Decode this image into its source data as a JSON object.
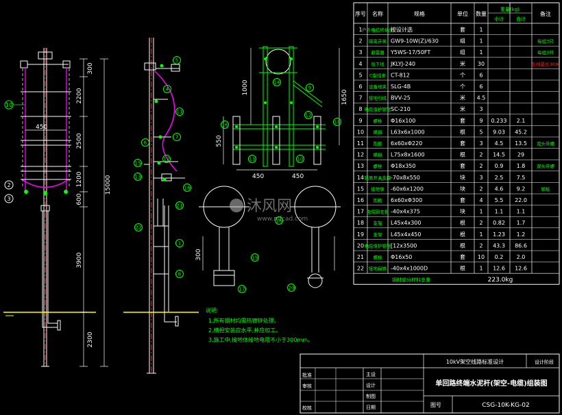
{
  "colors": {
    "background": "#000000",
    "line_white": "#ffffff",
    "line_green": "#00ff00",
    "line_magenta": "#ff00ff",
    "line_red": "#ff3030",
    "line_yellow": "#ffff00",
    "line_cyan": "#00ffff",
    "text_green": "#00ff00",
    "text_red": "#ff2020",
    "line_blue": "#3040ff"
  },
  "watermark": {
    "text": "沐风网",
    "url": "www.mfcad.com"
  },
  "table": {
    "headers": {
      "seq": "序号",
      "name": "名称",
      "spec": "规格",
      "unit": "单位",
      "qty": "数量",
      "weight": "重量(kg)",
      "sub": "小计",
      "total": "合计",
      "remark": "备注"
    },
    "rows": [
      {
        "n": "1",
        "name": "户外电缆终端头",
        "spec": "按设计选",
        "unit": "套",
        "qty": "1",
        "sub": "",
        "total": "",
        "remark": ""
      },
      {
        "n": "2",
        "name": "隔离开关",
        "spec": "GW9-10W(Z)/630",
        "unit": "组",
        "qty": "1",
        "sub": "",
        "total": "",
        "remark": "每组3只"
      },
      {
        "n": "3",
        "name": "避雷器",
        "spec": "Y5WS-17/50FT",
        "unit": "组",
        "qty": "1",
        "sub": "",
        "total": "",
        "remark": "每组3只"
      },
      {
        "n": "4",
        "name": "引下线",
        "spec": "JKLYJ-240",
        "unit": "米",
        "qty": "30",
        "sub": "",
        "total": "",
        "remark": "引线最长30米"
      },
      {
        "n": "5",
        "name": "C型线夹",
        "spec": "CT-812",
        "unit": "个",
        "qty": "6",
        "sub": "",
        "total": "",
        "remark": ""
      },
      {
        "n": "6",
        "name": "设备线夹",
        "spec": "SLG-4B",
        "unit": "个",
        "qty": "6",
        "sub": "",
        "total": "",
        "remark": ""
      },
      {
        "n": "7",
        "name": "接地引线",
        "spec": "BVV-25",
        "unit": "米",
        "qty": "4.5",
        "sub": "",
        "total": "",
        "remark": ""
      },
      {
        "n": "8",
        "name": "电缆保护钢管",
        "spec": "SC-210",
        "unit": "米",
        "qty": "3",
        "sub": "",
        "total": "",
        "remark": ""
      },
      {
        "n": "9",
        "name": "螺栓",
        "spec": "Φ16x100",
        "unit": "套",
        "qty": "9",
        "sub": "0.233",
        "total": "2.1",
        "remark": ""
      },
      {
        "n": "10",
        "name": "横担",
        "spec": "L63x6x1000",
        "unit": "根",
        "qty": "5",
        "sub": "9.03",
        "total": "45.2",
        "remark": ""
      },
      {
        "n": "11",
        "name": "抱箍",
        "spec": "6x60xΦ220",
        "unit": "套",
        "qty": "3",
        "sub": "4.5",
        "total": "13.5",
        "remark": "双头带螺"
      },
      {
        "n": "12",
        "name": "横担",
        "spec": "L75x8x1600",
        "unit": "根",
        "qty": "2",
        "sub": "14.5",
        "total": "29",
        "remark": ""
      },
      {
        "n": "13",
        "name": "螺栓",
        "spec": "Φ18x350",
        "unit": "套",
        "qty": "2",
        "sub": "0.9",
        "total": "1.8",
        "remark": "双头带螺"
      },
      {
        "n": "14",
        "name": "隔离开关支撑",
        "spec": "-70x8x550",
        "unit": "块",
        "qty": "3",
        "sub": "2.5",
        "total": "7.5",
        "remark": ""
      },
      {
        "n": "15",
        "name": "接地铁",
        "spec": "-60x6x1200",
        "unit": "块",
        "qty": "2",
        "sub": "4.6",
        "total": "9.2",
        "remark": "钢板"
      },
      {
        "n": "16",
        "name": "抱箍",
        "spec": "6x60xΦ300",
        "unit": "套",
        "qty": "4",
        "sub": "5.5",
        "total": "22.0",
        "remark": ""
      },
      {
        "n": "17",
        "name": "电缆固定板",
        "spec": "-40x4x375",
        "unit": "块",
        "qty": "1",
        "sub": "1.1",
        "total": "1.1",
        "remark": ""
      },
      {
        "n": "18",
        "name": "支架",
        "spec": "L45x4x300",
        "unit": "根",
        "qty": "2",
        "sub": "0.82",
        "total": "1.7",
        "remark": ""
      },
      {
        "n": "19",
        "name": "支架",
        "spec": "L45x4x450",
        "unit": "根",
        "qty": "1",
        "sub": "1.23",
        "total": "1.2",
        "remark": ""
      },
      {
        "n": "20",
        "name": "电缆保护钢管",
        "spec": "[12x3500",
        "unit": "根",
        "qty": "2",
        "sub": "43.3",
        "total": "86.6",
        "remark": ""
      },
      {
        "n": "21",
        "name": "螺栓",
        "spec": "Φ16x50",
        "unit": "套",
        "qty": "10",
        "sub": "0.2",
        "total": "2.0",
        "remark": ""
      },
      {
        "n": "22",
        "name": "接地扁铁",
        "spec": "-40x4x1000D",
        "unit": "根",
        "qty": "1",
        "sub": "12.6",
        "total": "12.6",
        "remark": ""
      }
    ],
    "footer": {
      "label": "钢材部分材料总重",
      "value": "223.0kg"
    }
  },
  "notes": {
    "title": "说明:",
    "lines": [
      "1.所有钢材均需热镀锌处理。",
      "2.横担安装应水平,并应加工。",
      "3.施工中,接地体接地电阻不小于300mm。"
    ]
  },
  "title_block": {
    "project": "10kV架空线路标准设计",
    "right_top": "设计阶段",
    "rows": [
      "批准",
      "审核",
      "校核"
    ],
    "roles": [
      "主设",
      "设计",
      "制图",
      "日期"
    ],
    "drawing_title": "单回路终端水泥杆(架空-电缆)组装图",
    "drawing_no_label": "图号",
    "drawing_no": "CSG-10K-KG-02"
  },
  "dims": {
    "left": [
      "300",
      "2200",
      "2500",
      "1200",
      "600",
      "3900",
      "2300"
    ],
    "left_total": "15000",
    "crossarm_width": "450",
    "plan": {
      "h1000": "1000",
      "h1650": "1650",
      "h550": "550",
      "w450a": "450",
      "w450b": "450"
    },
    "hoop": "300"
  },
  "callouts": {
    "left": [
      "10",
      "2",
      "3"
    ],
    "middle": [
      "5",
      "4",
      "11",
      "6",
      "7",
      "15",
      "13",
      "12",
      "16",
      "21",
      "22",
      "1",
      "8"
    ],
    "plan": [
      "14",
      "9",
      "12",
      "18",
      "11",
      "10",
      "16"
    ],
    "hoops": [
      "17",
      "19",
      "20",
      "16"
    ]
  }
}
